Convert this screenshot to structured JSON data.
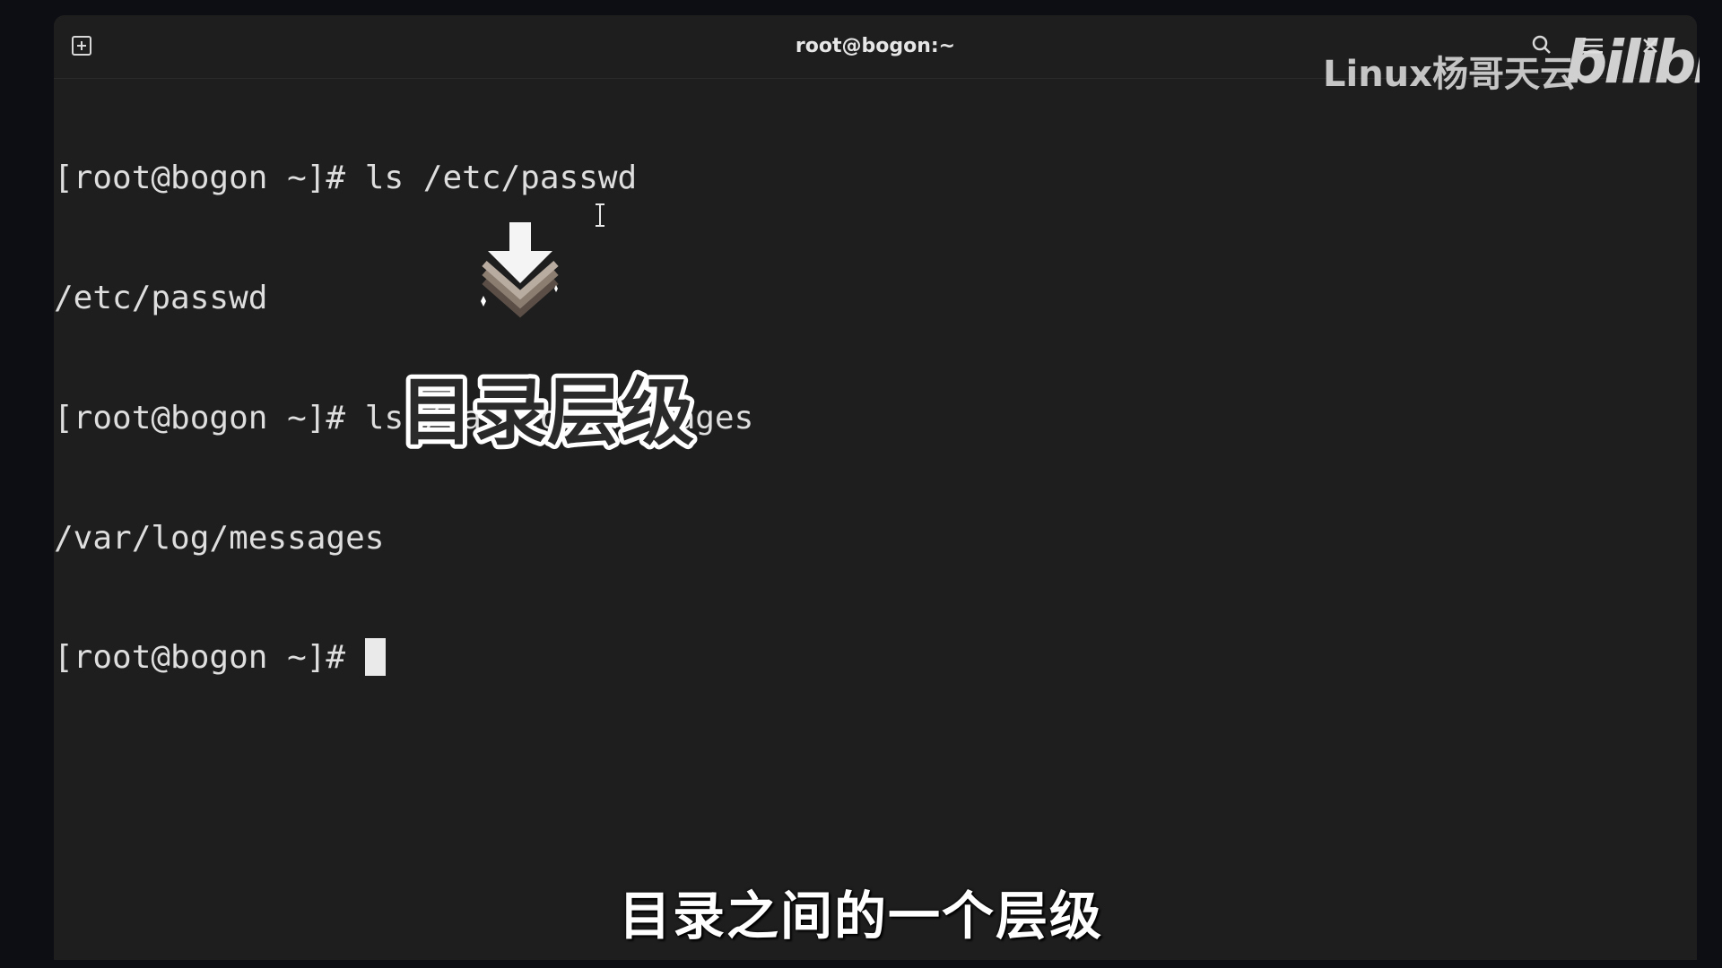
{
  "window": {
    "title": "root@bogon:~",
    "background": "#1e1e1e"
  },
  "watermark": {
    "channel": "Linux杨哥天云",
    "brand": "bilibili"
  },
  "terminal": {
    "lines": [
      "[root@bogon ~]# ls /etc/passwd",
      "/etc/passwd",
      "[root@bogon ~]# ls /var/log/messages",
      "/var/log/messages",
      "[root@bogon ~]# "
    ]
  },
  "overlay": {
    "heading": "目录层级",
    "arrow_icon": "down-arrow-icon"
  },
  "subtitle": "目录之间的一个层级",
  "icons": [
    "new-tab-icon",
    "search-icon",
    "menu-icon",
    "close-icon",
    "text-cursor-icon"
  ]
}
